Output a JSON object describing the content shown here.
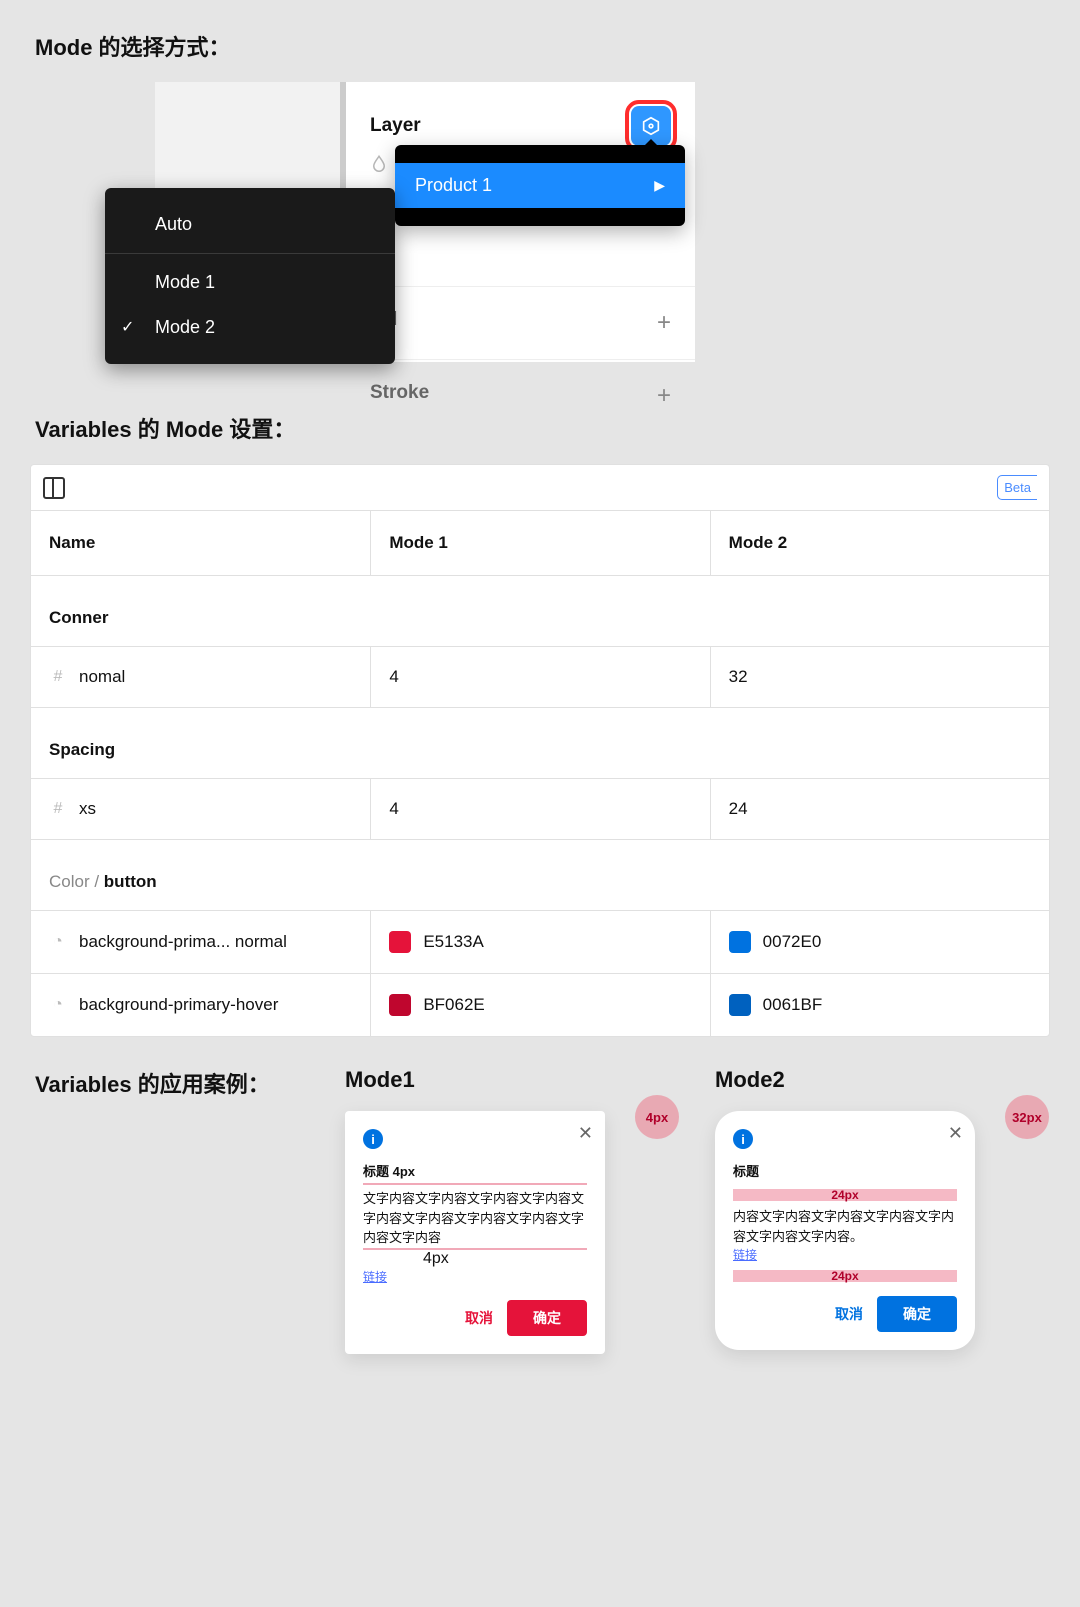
{
  "headings": {
    "mode_select": "Mode 的选择方式：",
    "vars_mode": "Variables 的 Mode 设置：",
    "vars_examples": "Variables 的应用案例："
  },
  "picker": {
    "layer": "Layer",
    "fill": "Fill",
    "stroke": "Stroke",
    "product1": "Product 1",
    "auto": "Auto",
    "mode1": "Mode 1",
    "mode2": "Mode 2"
  },
  "toolbar": {
    "beta": "Beta"
  },
  "table": {
    "cols": {
      "name": "Name",
      "mode1": "Mode 1",
      "mode2": "Mode 2"
    },
    "groups": {
      "conner": "Conner",
      "spacing": "Spacing",
      "color_prefix": "Color / ",
      "color_bold": "button"
    },
    "rows": {
      "nomal": {
        "name": "nomal",
        "m1": "4",
        "m2": "32"
      },
      "xs": {
        "name": "xs",
        "m1": "4",
        "m2": "24"
      },
      "bg_normal": {
        "name": "background-prima... normal",
        "m1": "E5133A",
        "m2": "0072E0",
        "c1": "#E5133A",
        "c2": "#0072E0"
      },
      "bg_hover": {
        "name": "background-primary-hover",
        "m1": "BF062E",
        "m2": "0061BF",
        "c1": "#BF062E",
        "c2": "#0061BF"
      }
    }
  },
  "examples": {
    "mode1_label": "Mode1",
    "mode2_label": "Mode2",
    "corner1": "4px",
    "corner2": "32px",
    "spacing1": "4px",
    "spacing2": "24px",
    "card": {
      "title": "标题",
      "body1": "文字内容文字内容文字内容文字内容文字内容文字内容文字内容文字内容文字内容文字内容",
      "body2": "内容文字内容文字内容文字内容文字内容文字内容文字内容。",
      "link": "链接",
      "cancel": "取消",
      "confirm": "确定"
    }
  }
}
